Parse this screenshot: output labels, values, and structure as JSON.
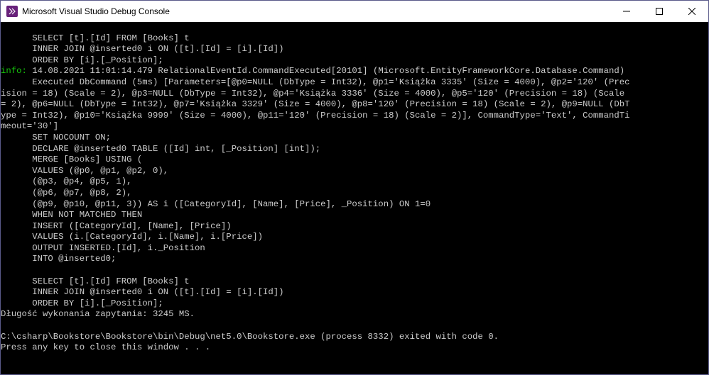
{
  "window": {
    "title": "Microsoft Visual Studio Debug Console"
  },
  "console": {
    "lines": {
      "l0": "      SELECT [t].[Id] FROM [Books] t",
      "l1": "      INNER JOIN @inserted0 i ON ([t].[Id] = [i].[Id])",
      "l2": "      ORDER BY [i].[_Position];",
      "l3_prefix": "info:",
      "l3_rest": " 14.08.2021 11:01:14.479 RelationalEventId.CommandExecuted[20101] (Microsoft.EntityFrameworkCore.Database.Command)",
      "l4": "      Executed DbCommand (5ms) [Parameters=[@p0=NULL (DbType = Int32), @p1='Książka 3335' (Size = 4000), @p2='120' (Prec",
      "l5": "ision = 18) (Scale = 2), @p3=NULL (DbType = Int32), @p4='Książka 3336' (Size = 4000), @p5='120' (Precision = 18) (Scale",
      "l6": "= 2), @p6=NULL (DbType = Int32), @p7='Książka 3329' (Size = 4000), @p8='120' (Precision = 18) (Scale = 2), @p9=NULL (DbT",
      "l7": "ype = Int32), @p10='Książka 9999' (Size = 4000), @p11='120' (Precision = 18) (Scale = 2)], CommandType='Text', CommandTi",
      "l8": "meout='30']",
      "l9": "      SET NOCOUNT ON;",
      "l10": "      DECLARE @inserted0 TABLE ([Id] int, [_Position] [int]);",
      "l11": "      MERGE [Books] USING (",
      "l12": "      VALUES (@p0, @p1, @p2, 0),",
      "l13": "      (@p3, @p4, @p5, 1),",
      "l14": "      (@p6, @p7, @p8, 2),",
      "l15": "      (@p9, @p10, @p11, 3)) AS i ([CategoryId], [Name], [Price], _Position) ON 1=0",
      "l16": "      WHEN NOT MATCHED THEN",
      "l17": "      INSERT ([CategoryId], [Name], [Price])",
      "l18": "      VALUES (i.[CategoryId], i.[Name], i.[Price])",
      "l19": "      OUTPUT INSERTED.[Id], i._Position",
      "l20": "      INTO @inserted0;",
      "l21": "",
      "l22": "      SELECT [t].[Id] FROM [Books] t",
      "l23": "      INNER JOIN @inserted0 i ON ([t].[Id] = [i].[Id])",
      "l24": "      ORDER BY [i].[_Position];",
      "l25": "Długość wykonania zapytania: 3245 MS.",
      "l26": "",
      "l27": "C:\\csharp\\Bookstore\\Bookstore\\bin\\Debug\\net5.0\\Bookstore.exe (process 8332) exited with code 0.",
      "l28": "Press any key to close this window . . ."
    }
  }
}
